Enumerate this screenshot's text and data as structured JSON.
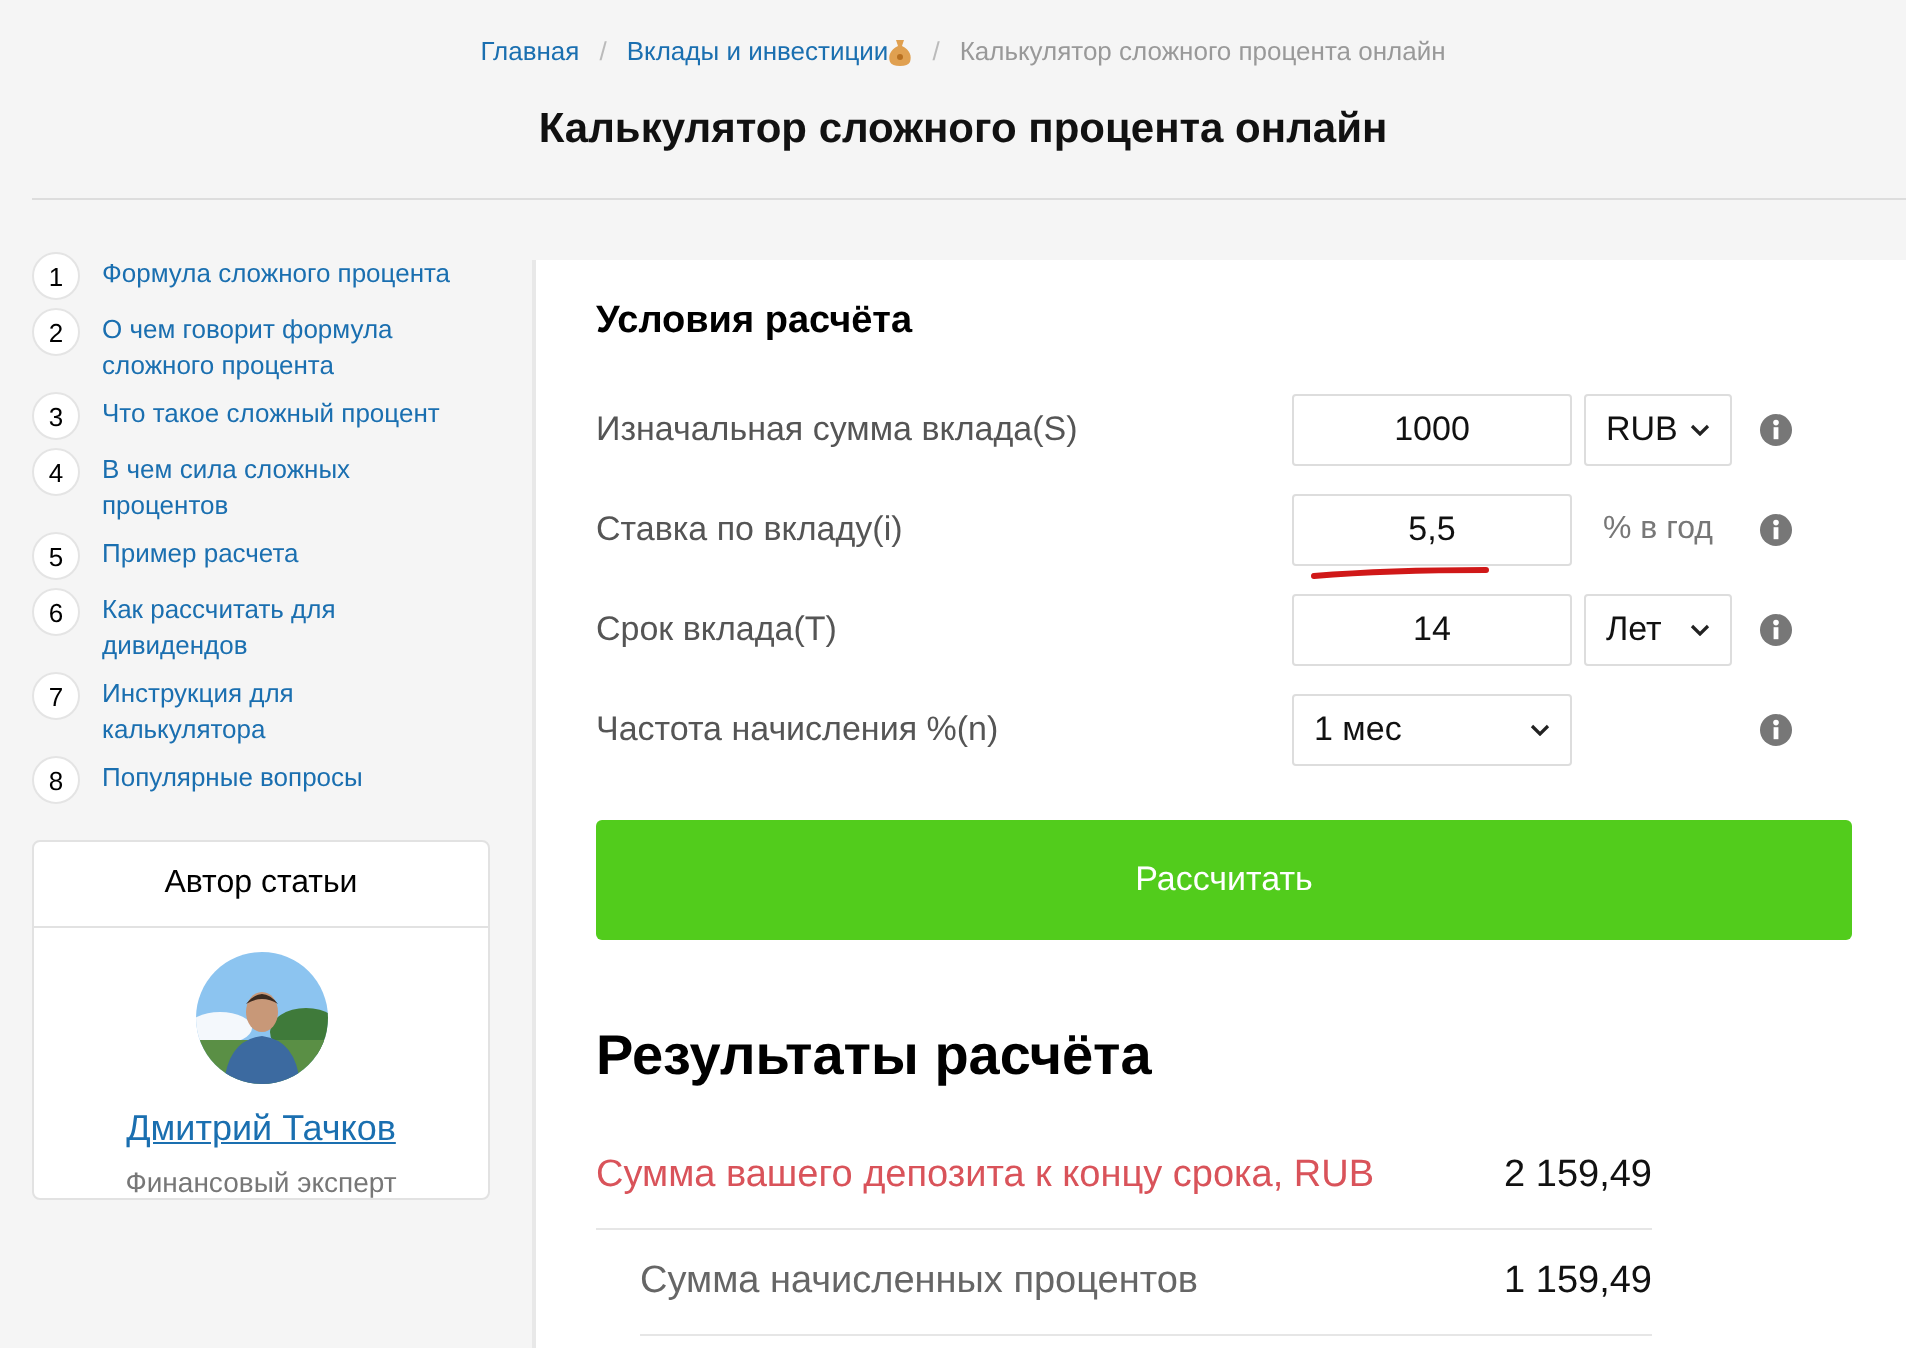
{
  "breadcrumb_separator": "/",
  "breadcrumbs": [
    {
      "label": "Главная",
      "current": false
    },
    {
      "label": "Вклады и инвестиции",
      "current": false
    },
    {
      "label": "Калькулятор сложного процента онлайн",
      "current": true
    }
  ],
  "title": "Калькулятор сложного процента онлайн",
  "toc": [
    {
      "number": "1",
      "label": "Формула сложного процента"
    },
    {
      "number": "2",
      "label": "О чем говорит формула сложного процента"
    },
    {
      "number": "3",
      "label": "Что такое сложный процент"
    },
    {
      "number": "4",
      "label": "В чем сила сложных процентов"
    },
    {
      "number": "5",
      "label": "Пример расчета"
    },
    {
      "number": "6",
      "label": "Как рассчитать для дивидендов"
    },
    {
      "number": "7",
      "label": "Инструкция для калькулятора"
    },
    {
      "number": "8",
      "label": "Популярные вопросы"
    }
  ],
  "author": {
    "heading": "Автор статьи",
    "name": "Дмитрий Тачков",
    "role": "Финансовый эксперт"
  },
  "form": {
    "heading": "Условия расчёта",
    "rows": [
      {
        "label": "Изначальная сумма вклада(S)",
        "kind": "input-select",
        "value": "1000",
        "option": "RUB",
        "underlined": false
      },
      {
        "label": "Ставка по вкладу(i)",
        "kind": "input-unit",
        "value": "5,5",
        "unit": "% в год",
        "underlined": true
      },
      {
        "label": "Срок вклада(T)",
        "kind": "input-select",
        "value": "14",
        "option": "Лет",
        "underlined": false
      },
      {
        "label": "Частота начисления %(n)",
        "kind": "select",
        "option": "1 мес",
        "underlined": false
      }
    ],
    "submit": "Рассчитать"
  },
  "results": {
    "heading": "Результаты расчёта",
    "rows": [
      {
        "kind": "total",
        "label": "Сумма вашего депозита к концу срока, RUB",
        "value": "2 159,49"
      },
      {
        "kind": "detail",
        "label": "Сумма начисленных процентов",
        "value": "1 159,49"
      }
    ]
  }
}
